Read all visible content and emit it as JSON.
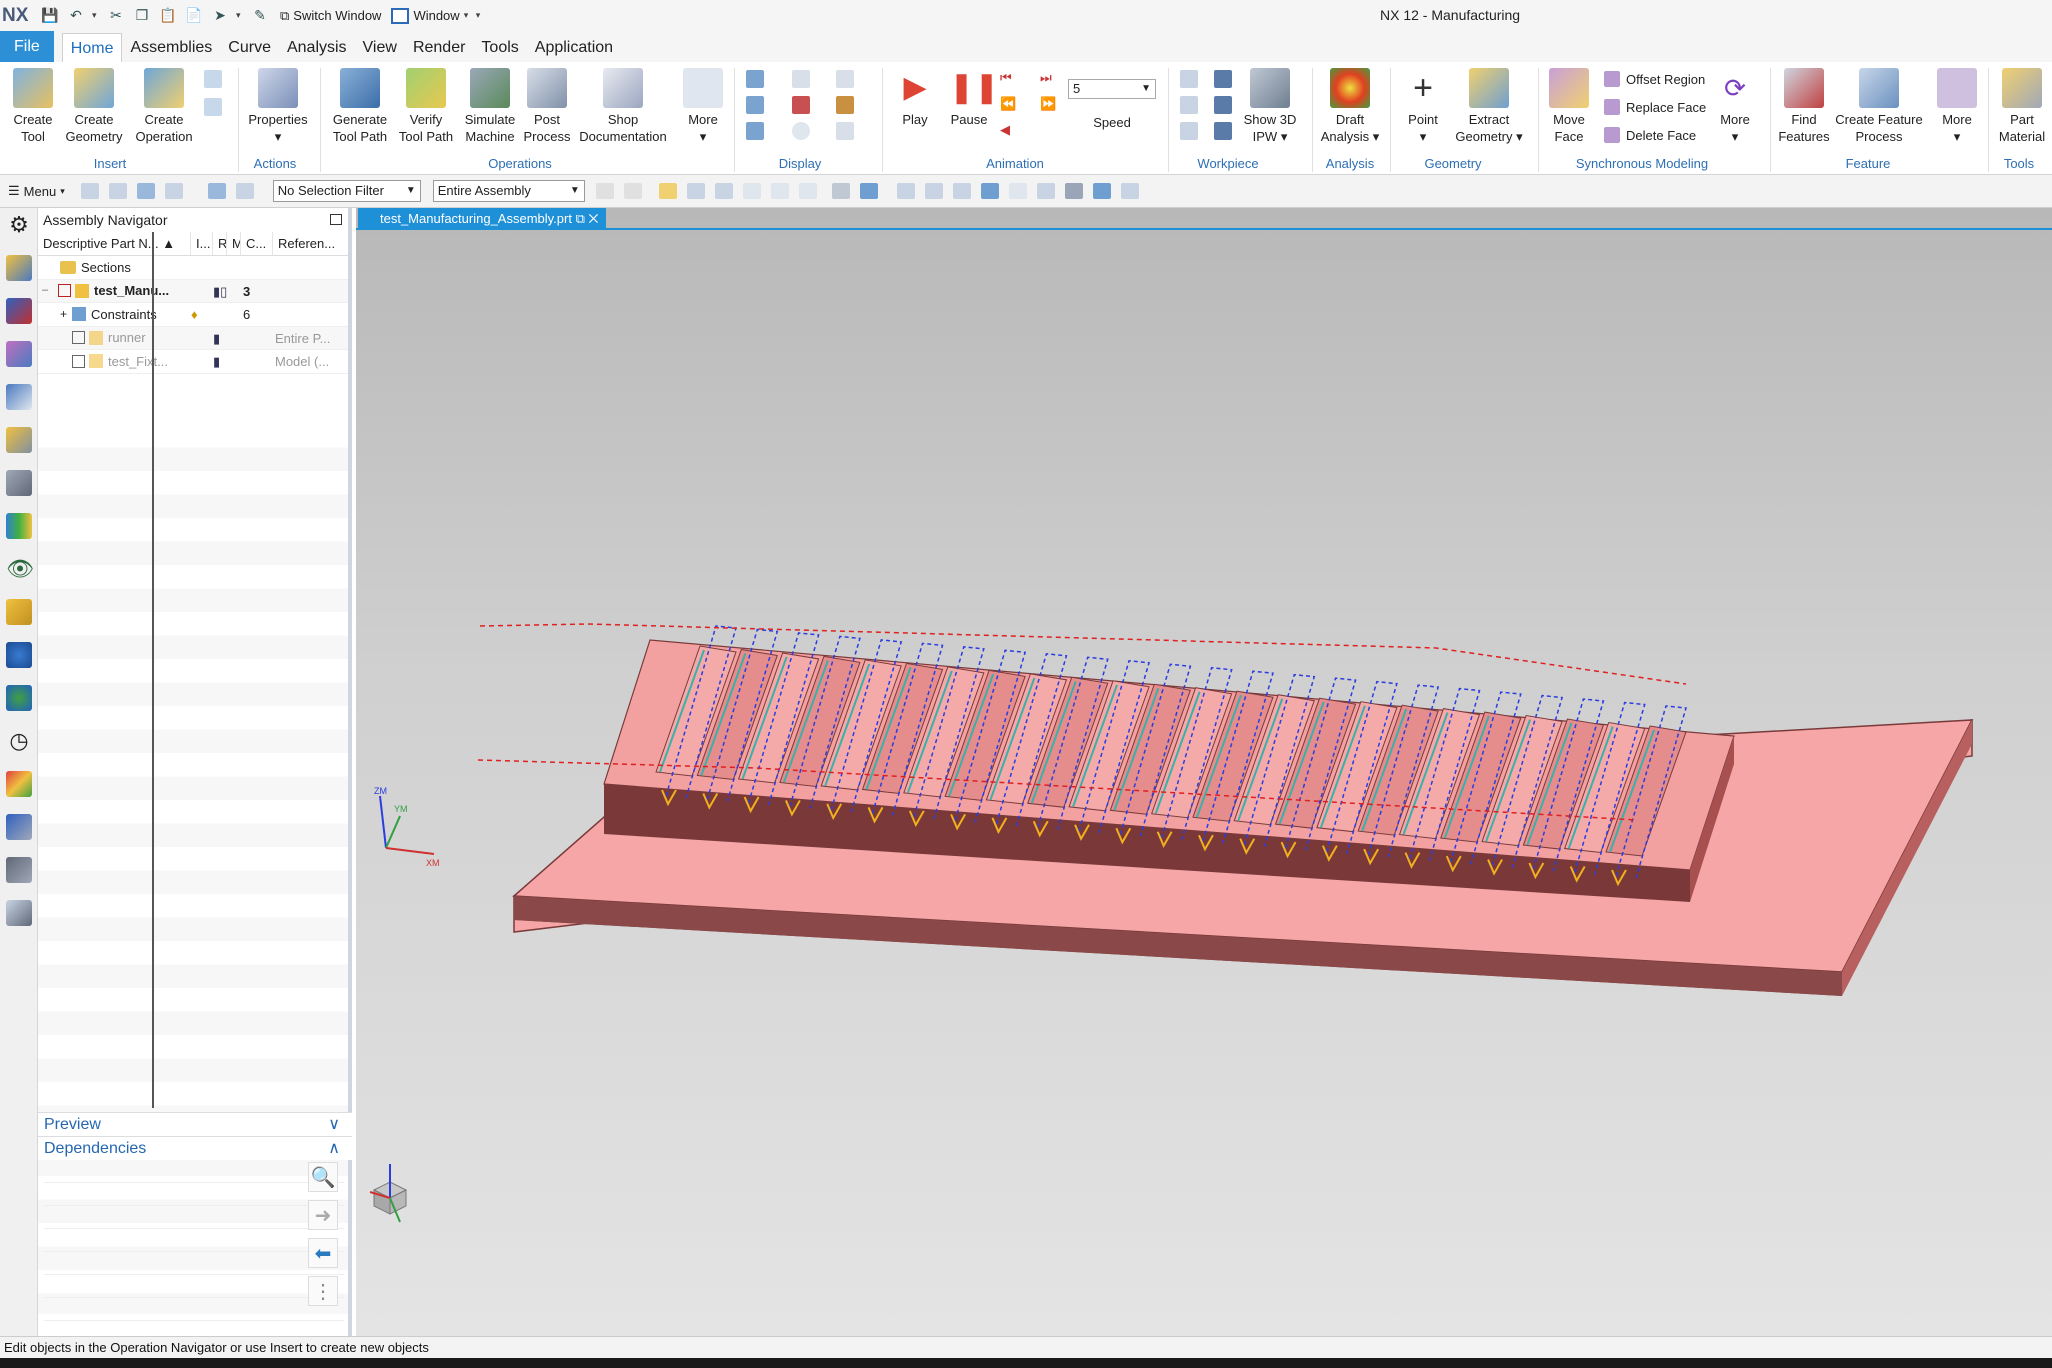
{
  "titlebar": {
    "logo": "NX",
    "switch_window": "Switch Window",
    "window": "Window",
    "title": "NX 12 - Manufacturing"
  },
  "menu": {
    "file": "File",
    "tabs": [
      "Home",
      "Assemblies",
      "Curve",
      "Analysis",
      "View",
      "Render",
      "Tools",
      "Application"
    ]
  },
  "ribbon": {
    "buttons": {
      "create_tool": [
        "Create",
        "Tool"
      ],
      "create_geometry": [
        "Create",
        "Geometry"
      ],
      "create_operation": [
        "Create",
        "Operation"
      ],
      "properties": "Properties",
      "generate_tool_path": [
        "Generate",
        "Tool Path"
      ],
      "verify_tool_path": [
        "Verify",
        "Tool Path"
      ],
      "simulate_machine": [
        "Simulate",
        "Machine"
      ],
      "post_process": [
        "Post",
        "Process"
      ],
      "shop_documentation": [
        "Shop",
        "Documentation"
      ],
      "more_ops": "More",
      "play": "Play",
      "pause": "Pause",
      "speed": "Speed",
      "speed_value": "5",
      "show_3d_ipw": [
        "Show 3D",
        "IPW"
      ],
      "draft_analysis": [
        "Draft",
        "Analysis"
      ],
      "point": "Point",
      "extract_geometry": [
        "Extract",
        "Geometry"
      ],
      "move_face": [
        "Move",
        "Face"
      ],
      "offset_region": "Offset Region",
      "replace_face": "Replace Face",
      "delete_face": "Delete Face",
      "more_sync": "More",
      "find_features": [
        "Find",
        "Features"
      ],
      "create_feature_process": [
        "Create Feature",
        "Process"
      ],
      "more_feature": "More",
      "part_material": [
        "Part",
        "Material"
      ]
    },
    "groups": {
      "insert": "Insert",
      "actions": "Actions",
      "operations": "Operations",
      "display": "Display",
      "animation": "Animation",
      "workpiece": "Workpiece",
      "analysis": "Analysis",
      "geometry": "Geometry",
      "synchronous_modeling": "Synchronous Modeling",
      "feature": "Feature",
      "tools": "Tools"
    }
  },
  "toolbar2": {
    "menu": "Menu",
    "selection_filter": "No Selection Filter",
    "scope": "Entire Assembly"
  },
  "navigator": {
    "title": "Assembly Navigator",
    "columns": [
      "Descriptive Part N...",
      "I...",
      "R",
      "M",
      "C...",
      "Referen..."
    ],
    "rows": [
      {
        "name": "Sections",
        "count": "",
        "ref": ""
      },
      {
        "name": "test_Manu...",
        "count": "3",
        "ref": ""
      },
      {
        "name": "Constraints",
        "count": "6",
        "ref": ""
      },
      {
        "name": "runner",
        "count": "",
        "ref": "Entire P..."
      },
      {
        "name": "test_Fixt...",
        "count": "",
        "ref": "Model (..."
      }
    ],
    "preview": "Preview",
    "dependencies": "Dependencies"
  },
  "viewport": {
    "doc_tab": "test_Manufacturing_Assembly.prt",
    "axis_labels": [
      "ZM",
      "YM",
      "XM"
    ]
  },
  "status": {
    "text": "Edit objects in the Operation Navigator or use Insert to create new objects"
  },
  "colors": {
    "accent": "#1e90d8",
    "part_top": "#f5a6a6",
    "part_side": "#8a4848",
    "toolpath_blue": "#2a3de0",
    "toolpath_red": "#e02020",
    "toolpath_yellow": "#f0b020"
  }
}
